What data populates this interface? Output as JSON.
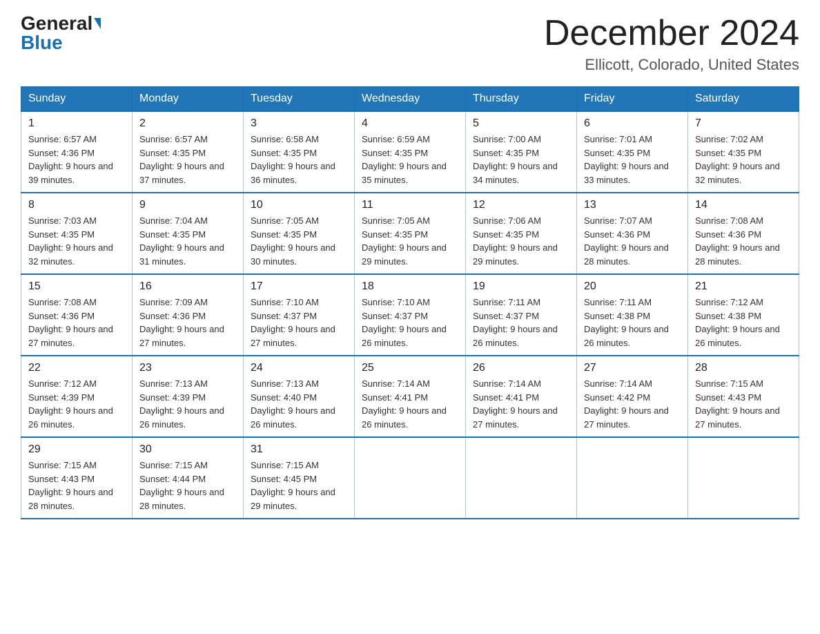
{
  "header": {
    "logo_general": "General",
    "logo_blue": "Blue",
    "month_title": "December 2024",
    "location": "Ellicott, Colorado, United States"
  },
  "days_of_week": [
    "Sunday",
    "Monday",
    "Tuesday",
    "Wednesday",
    "Thursday",
    "Friday",
    "Saturday"
  ],
  "weeks": [
    [
      {
        "day": "1",
        "sunrise": "6:57 AM",
        "sunset": "4:36 PM",
        "daylight": "9 hours and 39 minutes."
      },
      {
        "day": "2",
        "sunrise": "6:57 AM",
        "sunset": "4:35 PM",
        "daylight": "9 hours and 37 minutes."
      },
      {
        "day": "3",
        "sunrise": "6:58 AM",
        "sunset": "4:35 PM",
        "daylight": "9 hours and 36 minutes."
      },
      {
        "day": "4",
        "sunrise": "6:59 AM",
        "sunset": "4:35 PM",
        "daylight": "9 hours and 35 minutes."
      },
      {
        "day": "5",
        "sunrise": "7:00 AM",
        "sunset": "4:35 PM",
        "daylight": "9 hours and 34 minutes."
      },
      {
        "day": "6",
        "sunrise": "7:01 AM",
        "sunset": "4:35 PM",
        "daylight": "9 hours and 33 minutes."
      },
      {
        "day": "7",
        "sunrise": "7:02 AM",
        "sunset": "4:35 PM",
        "daylight": "9 hours and 32 minutes."
      }
    ],
    [
      {
        "day": "8",
        "sunrise": "7:03 AM",
        "sunset": "4:35 PM",
        "daylight": "9 hours and 32 minutes."
      },
      {
        "day": "9",
        "sunrise": "7:04 AM",
        "sunset": "4:35 PM",
        "daylight": "9 hours and 31 minutes."
      },
      {
        "day": "10",
        "sunrise": "7:05 AM",
        "sunset": "4:35 PM",
        "daylight": "9 hours and 30 minutes."
      },
      {
        "day": "11",
        "sunrise": "7:05 AM",
        "sunset": "4:35 PM",
        "daylight": "9 hours and 29 minutes."
      },
      {
        "day": "12",
        "sunrise": "7:06 AM",
        "sunset": "4:35 PM",
        "daylight": "9 hours and 29 minutes."
      },
      {
        "day": "13",
        "sunrise": "7:07 AM",
        "sunset": "4:36 PM",
        "daylight": "9 hours and 28 minutes."
      },
      {
        "day": "14",
        "sunrise": "7:08 AM",
        "sunset": "4:36 PM",
        "daylight": "9 hours and 28 minutes."
      }
    ],
    [
      {
        "day": "15",
        "sunrise": "7:08 AM",
        "sunset": "4:36 PM",
        "daylight": "9 hours and 27 minutes."
      },
      {
        "day": "16",
        "sunrise": "7:09 AM",
        "sunset": "4:36 PM",
        "daylight": "9 hours and 27 minutes."
      },
      {
        "day": "17",
        "sunrise": "7:10 AM",
        "sunset": "4:37 PM",
        "daylight": "9 hours and 27 minutes."
      },
      {
        "day": "18",
        "sunrise": "7:10 AM",
        "sunset": "4:37 PM",
        "daylight": "9 hours and 26 minutes."
      },
      {
        "day": "19",
        "sunrise": "7:11 AM",
        "sunset": "4:37 PM",
        "daylight": "9 hours and 26 minutes."
      },
      {
        "day": "20",
        "sunrise": "7:11 AM",
        "sunset": "4:38 PM",
        "daylight": "9 hours and 26 minutes."
      },
      {
        "day": "21",
        "sunrise": "7:12 AM",
        "sunset": "4:38 PM",
        "daylight": "9 hours and 26 minutes."
      }
    ],
    [
      {
        "day": "22",
        "sunrise": "7:12 AM",
        "sunset": "4:39 PM",
        "daylight": "9 hours and 26 minutes."
      },
      {
        "day": "23",
        "sunrise": "7:13 AM",
        "sunset": "4:39 PM",
        "daylight": "9 hours and 26 minutes."
      },
      {
        "day": "24",
        "sunrise": "7:13 AM",
        "sunset": "4:40 PM",
        "daylight": "9 hours and 26 minutes."
      },
      {
        "day": "25",
        "sunrise": "7:14 AM",
        "sunset": "4:41 PM",
        "daylight": "9 hours and 26 minutes."
      },
      {
        "day": "26",
        "sunrise": "7:14 AM",
        "sunset": "4:41 PM",
        "daylight": "9 hours and 27 minutes."
      },
      {
        "day": "27",
        "sunrise": "7:14 AM",
        "sunset": "4:42 PM",
        "daylight": "9 hours and 27 minutes."
      },
      {
        "day": "28",
        "sunrise": "7:15 AM",
        "sunset": "4:43 PM",
        "daylight": "9 hours and 27 minutes."
      }
    ],
    [
      {
        "day": "29",
        "sunrise": "7:15 AM",
        "sunset": "4:43 PM",
        "daylight": "9 hours and 28 minutes."
      },
      {
        "day": "30",
        "sunrise": "7:15 AM",
        "sunset": "4:44 PM",
        "daylight": "9 hours and 28 minutes."
      },
      {
        "day": "31",
        "sunrise": "7:15 AM",
        "sunset": "4:45 PM",
        "daylight": "9 hours and 29 minutes."
      },
      null,
      null,
      null,
      null
    ]
  ],
  "labels": {
    "sunrise": "Sunrise:",
    "sunset": "Sunset:",
    "daylight": "Daylight:"
  }
}
